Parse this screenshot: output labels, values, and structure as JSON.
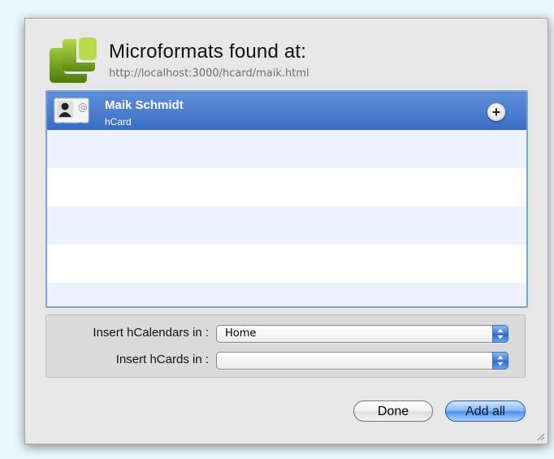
{
  "header": {
    "title": "Microformats found at:",
    "url": "http://localhost:3000/hcard/maik.html"
  },
  "list": {
    "items": [
      {
        "name": "Maik Schmidt",
        "type": "hCard",
        "icon": "contact-card-icon",
        "selected": true
      }
    ]
  },
  "settings": {
    "hcalendars_label": "Insert hCalendars in :",
    "hcalendars_value": "Home",
    "hcards_label": "Insert hCards in :",
    "hcards_value": ""
  },
  "buttons": {
    "done_label": "Done",
    "add_all_label": "Add all"
  },
  "colors": {
    "selection": "#3f73c9",
    "alt_row": "#edf3fe",
    "default_button": "#4f92ec"
  }
}
